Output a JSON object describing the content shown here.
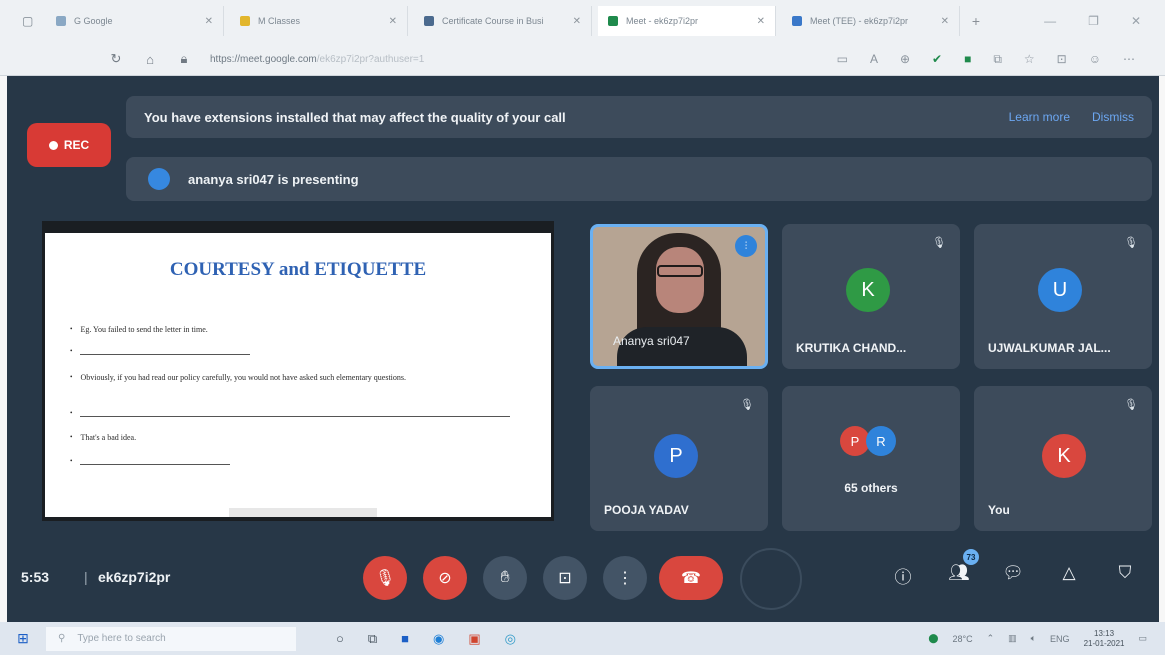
{
  "browser": {
    "tabs": [
      {
        "title": "G Google",
        "favicon_color": "#8aa8c4"
      },
      {
        "title": "M Classes",
        "favicon_color": "#e2b62d"
      },
      {
        "title": "Certificate Course in Busi",
        "favicon_color": "#4b6a8e"
      },
      {
        "title": "Meet - ek6zp7i2pr",
        "favicon_color": "#1f8a4c"
      },
      {
        "title": "Meet (TEE) - ek6zp7i2pr",
        "favicon_color": "#3a78c9"
      }
    ],
    "new_tab_label": "+",
    "url_main": "https://meet.google.com",
    "url_rest": "/ek6zp7i2pr?authuser=1"
  },
  "meet": {
    "rec_label": "REC",
    "extensions_banner": "You have extensions installed that may affect the quality of your call",
    "learn_more": "Learn more",
    "dismiss": "Dismiss",
    "presenting_text": "ananya sri047 is presenting",
    "slide": {
      "title": "COURTESY and ETIQUETTE",
      "lines": [
        "Eg. You failed to send the letter in time.",
        "Obviously, if you had read our policy carefully, you would not have asked such elementary questions.",
        "That's a bad idea."
      ]
    },
    "tiles": [
      {
        "name": "Ananya sri047",
        "type": "video"
      },
      {
        "name": "KRUTIKA CHAND...",
        "initial": "K",
        "color": "#2f9a45"
      },
      {
        "name": "UJWALKUMAR JAL...",
        "initial": "U",
        "color": "#2f83db"
      },
      {
        "name": "POOJA YADAV",
        "initial": "P",
        "color": "#2f6fcf"
      },
      {
        "name": "65 others",
        "initial_a": "P",
        "initial_b": "R"
      },
      {
        "name": "You",
        "initial": "K",
        "color": "#d9473e"
      }
    ],
    "time": "5:53",
    "separator": "|",
    "meeting_code": "ek6zp7i2pr",
    "participants_count": "73"
  },
  "taskbar": {
    "search_placeholder": "Type here to search",
    "weather": "28°C",
    "language": "ENG",
    "time": "13:13",
    "date": "21-01-2021"
  }
}
